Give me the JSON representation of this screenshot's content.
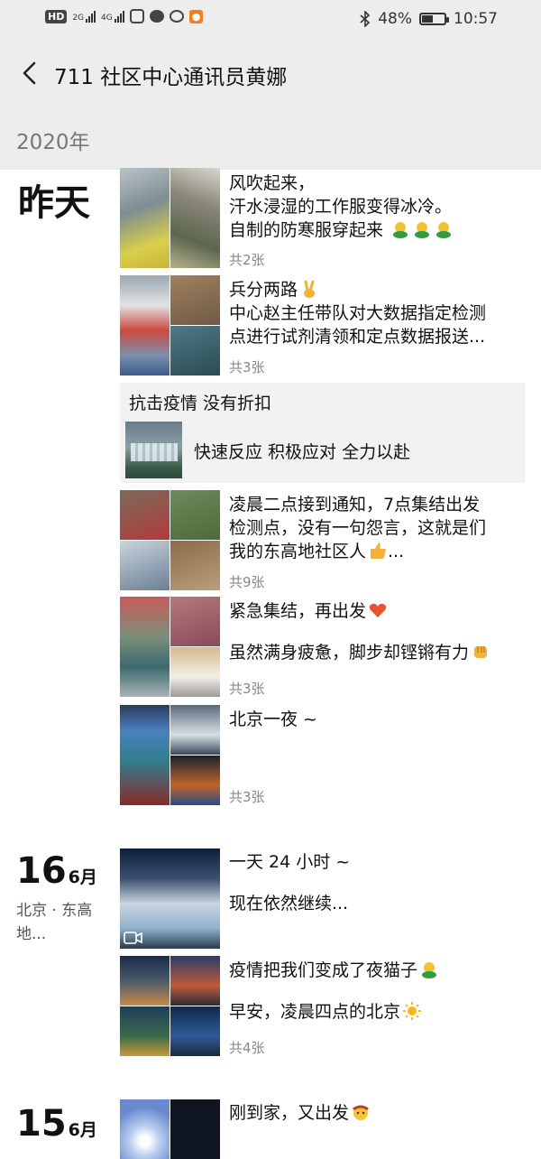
{
  "status": {
    "left_icons": [
      "hd-icon",
      "signal-2g-icon",
      "signal-4g-icon",
      "shield-app-icon",
      "chat-bubble-icon",
      "message-icon",
      "app-badge-icon"
    ],
    "hd_label": "HD",
    "net1": "2G",
    "net2": "4G",
    "bluetooth_icon": "bluetooth-icon",
    "battery": "48%",
    "battery_level": 0.48,
    "time": "10:57"
  },
  "header": {
    "title": "711 社区中心通讯员黄娜",
    "back_icon": "chevron-left-icon"
  },
  "year": "2020年",
  "groups": [
    {
      "day": "昨天",
      "posts": [
        {
          "lines": [
            "风吹起来，",
            "汗水浸湿的工作服变得冰冷。",
            "自制的防寒服穿起来"
          ],
          "emoji": "green-hands-emoji x3",
          "count": "共2张"
        },
        {
          "lines": [
            "兵分两路",
            "中心赵主任带队对大数据指定检测",
            "点进行试剂清领和定点数据报送..."
          ],
          "emoji": "victory-hand-emoji",
          "count": "共3张"
        },
        {
          "share_title": "抗击疫情  没有折扣",
          "share_text": "快速反应 积极应对 全力以赴"
        },
        {
          "lines": [
            "凌晨二点接到通知，7点集结出发",
            "检测点，没有一句怨言，这就是们",
            "我的东高地社区人"
          ],
          "emoji": "thumbs-up-emoji",
          "suffix": "...",
          "count": "共9张"
        },
        {
          "lines": [
            "紧急集结，再出发",
            "虽然满身疲惫，脚步却铿锵有力"
          ],
          "emoji": "heart-emoji / fist-emoji",
          "count": "共3张"
        },
        {
          "lines": [
            "北京一夜 ~"
          ],
          "count": "共3张"
        }
      ]
    },
    {
      "day_num": "16",
      "month": "6月",
      "location": "北京 · 东高地...",
      "posts": [
        {
          "lines": [
            "一天 24 小时 ~",
            "现在依然继续..."
          ],
          "video": true
        },
        {
          "lines": [
            "疫情把我们变成了夜猫子",
            "早安，凌晨四点的北京"
          ],
          "emoji": "green-hands-emoji / sun-emoji",
          "count": "共4张"
        }
      ]
    },
    {
      "day_num": "15",
      "month": "6月",
      "posts": [
        {
          "lines": [
            "刚到家，又出发"
          ],
          "emoji": "cowboy-emoji"
        }
      ]
    }
  ]
}
